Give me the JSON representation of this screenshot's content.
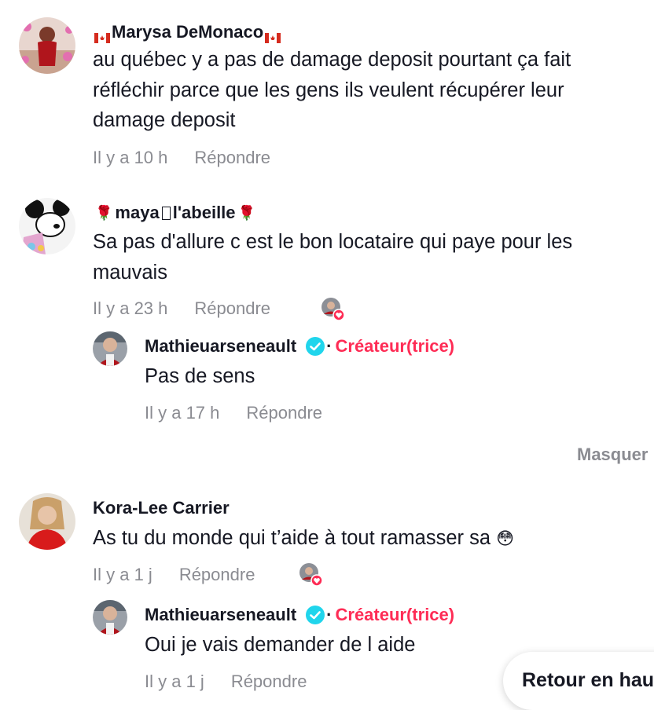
{
  "comments": [
    {
      "username": "Marysa DeMonaco",
      "username_decoration": "canada-flag",
      "text": "au québec y a pas de damage deposit pourtant ça fait réfléchir parce que les gens ils veulent récupérer leur damage deposit",
      "time": "Il y a 10 h",
      "reply_label": "Répondre"
    },
    {
      "username": "maya",
      "username_suffix": "l'abeille",
      "username_decoration": "rose-icon",
      "text": "Sa pas d'allure c est le bon locataire qui paye pour les mauvais",
      "time": "Il y a 23 h",
      "reply_label": "Répondre",
      "liked_by_creator": true,
      "reply": {
        "username": "Mathieuarseneault",
        "badge": "Créateur(trice)",
        "text": "Pas de sens",
        "time": "Il y a 17 h",
        "reply_label": "Répondre"
      }
    },
    {
      "username": "Kora-Lee Carrier",
      "text": "As tu du monde qui t’aide à tout ramasser sa",
      "emoji": "😳",
      "time": "Il y a 1 j",
      "reply_label": "Répondre",
      "liked_by_creator": true,
      "reply": {
        "username": "Mathieuarseneault",
        "badge": "Créateur(trice)",
        "text": "Oui je vais demander de l aide",
        "time": "Il y a 1 j",
        "reply_label": "Répondre"
      }
    }
  ],
  "hide_label": "Masquer",
  "back_to_top_label": "Retour en haut",
  "colors": {
    "creator_tag": "#fe2c55",
    "verified": "#20d5ec",
    "meta_gray": "#8a8b91",
    "text": "#161823"
  }
}
